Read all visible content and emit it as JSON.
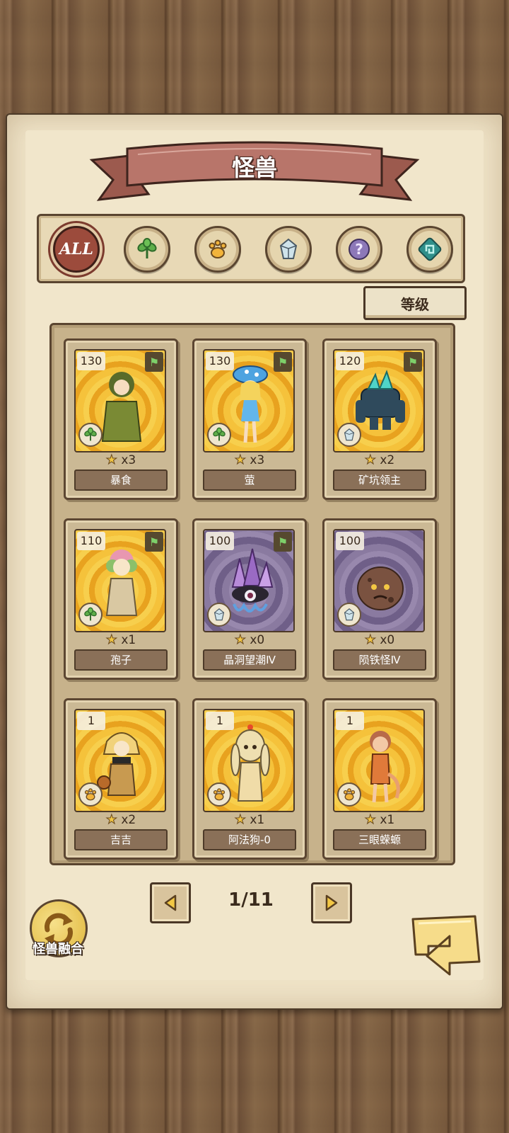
{
  "header": {
    "title": "怪兽"
  },
  "filters": [
    {
      "label": "ALL",
      "icon": "all-icon",
      "active": true
    },
    {
      "label": "",
      "icon": "leaf-icon",
      "active": false
    },
    {
      "label": "",
      "icon": "paw-icon",
      "active": false
    },
    {
      "label": "",
      "icon": "crystal-icon",
      "active": false
    },
    {
      "label": "",
      "icon": "question-icon",
      "active": false
    },
    {
      "label": "",
      "icon": "spiral-icon",
      "active": false
    }
  ],
  "sort": {
    "label": "等级"
  },
  "cards": [
    {
      "level": "130",
      "stars": "x3",
      "name": "暴食",
      "bg": "gold",
      "type": "leaf",
      "flag": true
    },
    {
      "level": "130",
      "stars": "x3",
      "name": "萤",
      "bg": "gold",
      "type": "leaf",
      "flag": true
    },
    {
      "level": "120",
      "stars": "x2",
      "name": "矿坑领主",
      "bg": "gold",
      "type": "crystal",
      "flag": true
    },
    {
      "level": "110",
      "stars": "x1",
      "name": "孢子",
      "bg": "gold",
      "type": "leaf",
      "flag": true
    },
    {
      "level": "100",
      "stars": "x0",
      "name": "晶洞望潮Ⅳ",
      "bg": "purple",
      "type": "crystal",
      "flag": true
    },
    {
      "level": "100",
      "stars": "x0",
      "name": "陨铁怪Ⅳ",
      "bg": "purple",
      "type": "crystal",
      "flag": false
    },
    {
      "level": "1",
      "stars": "x2",
      "name": "吉吉",
      "bg": "gold",
      "type": "paw",
      "flag": false
    },
    {
      "level": "1",
      "stars": "x1",
      "name": "阿法狗-0",
      "bg": "gold",
      "type": "paw",
      "flag": false
    },
    {
      "level": "1",
      "stars": "x1",
      "name": "三眼蝾螈",
      "bg": "gold",
      "type": "paw",
      "flag": false
    }
  ],
  "pagination": {
    "current": "1/11"
  },
  "fusion": {
    "label": "怪兽融合"
  },
  "colors": {
    "gold": "#f5c23b",
    "purple": "#7c6c94",
    "ribbon": "#b8756a",
    "accent": "#9c4b3c"
  }
}
